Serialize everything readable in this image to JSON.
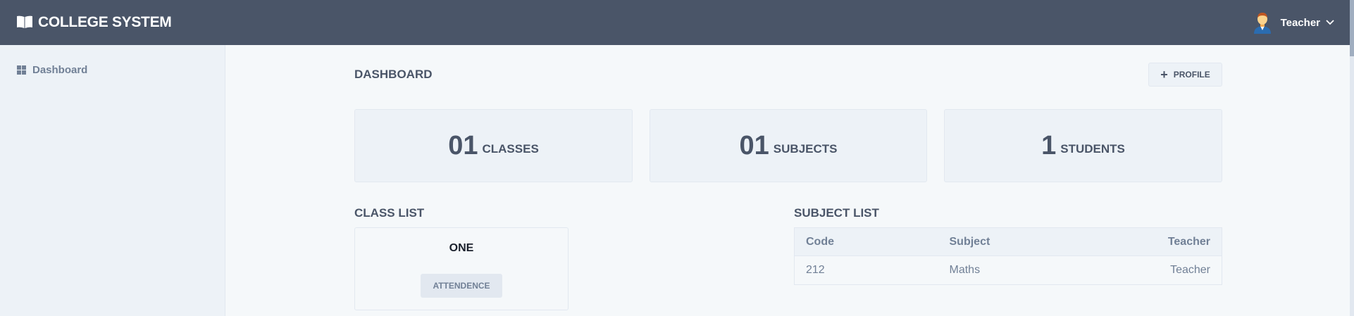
{
  "header": {
    "brand_title": "COLLEGE SYSTEM",
    "brand_icon": "book-icon",
    "user_name": "Teacher",
    "avatar_icon": "teacher-avatar",
    "background": "#4a5568"
  },
  "sidebar": {
    "items": [
      {
        "label": "Dashboard",
        "icon": "grid-icon"
      }
    ]
  },
  "main": {
    "title": "DASHBOARD",
    "profile_button": "PROFILE",
    "stats": [
      {
        "value": "01",
        "label": "CLASSES"
      },
      {
        "value": "01",
        "label": "SUBJECTS"
      },
      {
        "value": "1",
        "label": "STUDENTS"
      }
    ],
    "class_list": {
      "title": "CLASS LIST",
      "classes": [
        {
          "name": "ONE",
          "button": "ATTENDENCE"
        }
      ]
    },
    "subject_list": {
      "title": "SUBJECT LIST",
      "columns": [
        "Code",
        "Subject",
        "Teacher"
      ],
      "rows": [
        [
          "212",
          "Maths",
          "Teacher"
        ]
      ]
    }
  }
}
